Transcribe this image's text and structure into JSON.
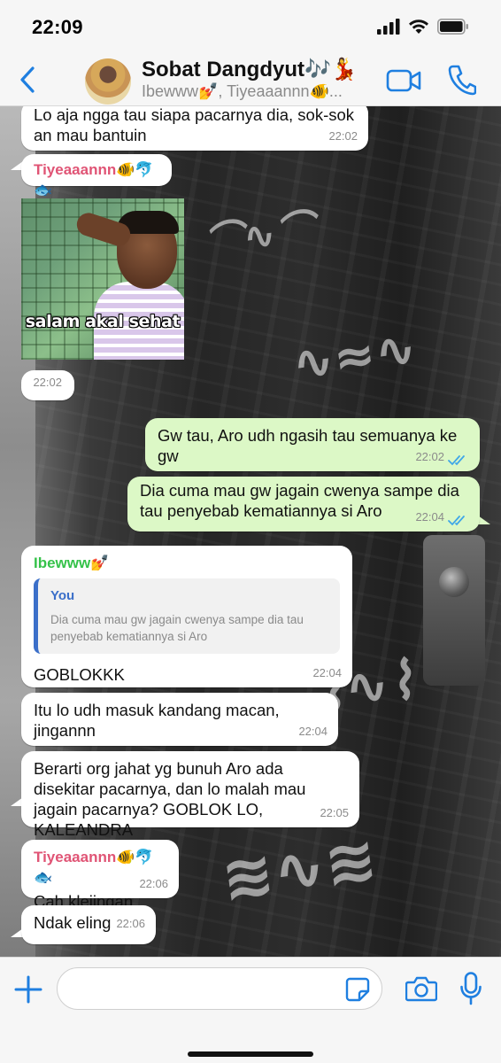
{
  "status_bar": {
    "time": "22:09",
    "icons": [
      "cellular-signal-icon",
      "wifi-icon",
      "battery-icon"
    ]
  },
  "header": {
    "back_icon": "chevron-left-icon",
    "title": "Sobat Dangdyut🎶💃",
    "subtitle": "Ibewww💅, Tiyeaaannn🐠...",
    "accent_color": "#1f7fe0",
    "action_icons": [
      "video-call-icon",
      "phone-call-icon"
    ]
  },
  "messages": [
    {
      "direction": "in",
      "text": "Lo aja ngga tau siapa pacarnya dia, sok-sok an mau bantuin",
      "time": "22:02"
    },
    {
      "direction": "in",
      "sender": "Tiyeaaannn🐠🐬🐟",
      "sender_color": "#e05475",
      "image_caption": "salam akal sehat",
      "time": "22:02"
    },
    {
      "direction": "out",
      "text": "Gw tau, Aro udh ngasih tau semuanya ke gw",
      "time": "22:02"
    },
    {
      "direction": "out",
      "text": "Dia cuma mau gw jagain cwenya sampe dia tau penyebab kematiannya si Aro",
      "time": "22:04"
    },
    {
      "direction": "in",
      "sender": "Ibewww💅",
      "sender_color": "#35c24a",
      "quote_author": "You",
      "quote_text": "Dia cuma mau gw jagain cwenya sampe dia tau penyebab kematiannya si Aro",
      "text": "GOBLOKKK",
      "time": "22:04"
    },
    {
      "direction": "in",
      "text": "Itu lo udh masuk kandang macan, jingannn",
      "time": "22:04"
    },
    {
      "direction": "in",
      "text": "Berarti org jahat yg bunuh Aro ada disekitar pacarnya, dan lo malah mau jagain pacarnya? GOBLOK LO, KALEANDRA",
      "time": "22:05"
    },
    {
      "direction": "in",
      "sender": "Tiyeaaannn🐠🐬🐟",
      "sender_color": "#e05475",
      "text": "Cah klejingan",
      "time": "22:06"
    },
    {
      "direction": "in",
      "text": "Ndak eling",
      "time": "22:06"
    }
  ],
  "input_bar": {
    "placeholder": "",
    "icons": [
      "plus-icon",
      "sticker-icon",
      "camera-icon",
      "microphone-icon"
    ]
  },
  "colors": {
    "incoming_bubble": "#ffffff",
    "outgoing_bubble": "#dcf8c6",
    "read_ticks": "#3fa7e8",
    "quote_bar": "#3b6fc9"
  }
}
